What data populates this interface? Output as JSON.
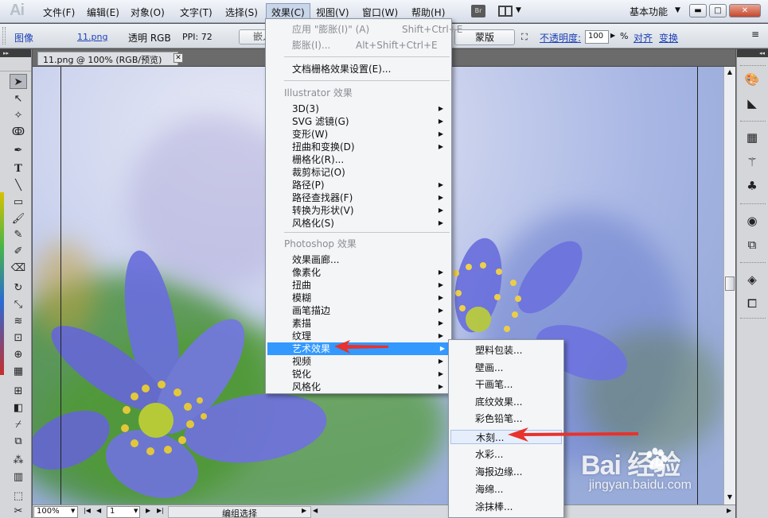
{
  "menubar": {
    "logo": "Ai",
    "items": [
      "文件(F)",
      "编辑(E)",
      "对象(O)",
      "文字(T)",
      "选择(S)",
      "效果(C)",
      "视图(V)",
      "窗口(W)",
      "帮助(H)"
    ],
    "active_item": "效果(C)",
    "bridge_badge": "Br",
    "workspace": "基本功能",
    "window_buttons": [
      "▬",
      "□",
      "✕"
    ]
  },
  "controlbar": {
    "object_type": "图像",
    "file_link": "11.png",
    "transparency_label": "透明 RGB",
    "ppi_label": "PPI: 72",
    "embed_button": "嵌入",
    "mask_button": "蒙版",
    "opacity_label": "不透明度:",
    "opacity_value": "100",
    "opacity_unit": "%",
    "align_link": "对齐",
    "transform_link": "变换"
  },
  "document": {
    "tab_title": "11.png @ 100% (RGB/预览)"
  },
  "statusbar": {
    "zoom": "100%",
    "page": "1",
    "status": "编组选择"
  },
  "effect_menu": {
    "apply_last": {
      "label": "应用 \"膨胀(I)\" (A)",
      "shortcut": "Shift+Ctrl+E"
    },
    "last_effect": {
      "label": "膨胀(I)...",
      "shortcut": "Alt+Shift+Ctrl+E"
    },
    "raster_settings": "文档栅格效果设置(E)...",
    "illustrator_header": "Illustrator 效果",
    "illustrator_items": [
      "3D(3)",
      "SVG 滤镜(G)",
      "变形(W)",
      "扭曲和变换(D)",
      "栅格化(R)...",
      "裁剪标记(O)",
      "路径(P)",
      "路径查找器(F)",
      "转换为形状(V)",
      "风格化(S)"
    ],
    "photoshop_header": "Photoshop 效果",
    "photoshop_items": [
      "效果画廊...",
      "像素化",
      "扭曲",
      "模糊",
      "画笔描边",
      "素描",
      "纹理",
      "艺术效果",
      "视频",
      "锐化",
      "风格化"
    ],
    "highlighted": "艺术效果"
  },
  "artistic_submenu": {
    "items": [
      "塑料包装...",
      "壁画...",
      "干画笔...",
      "底纹效果...",
      "彩色铅笔...",
      "木刻...",
      "水彩...",
      "海报边缘...",
      "海绵...",
      "涂抹棒..."
    ],
    "hovered": "木刻..."
  },
  "watermark": {
    "brand": "Bai  经验",
    "url": "jingyan.baidu.com"
  },
  "colors": {
    "menu_highlight": "#3399ff",
    "arrow": "#e8322b",
    "link": "#1c40b7"
  }
}
